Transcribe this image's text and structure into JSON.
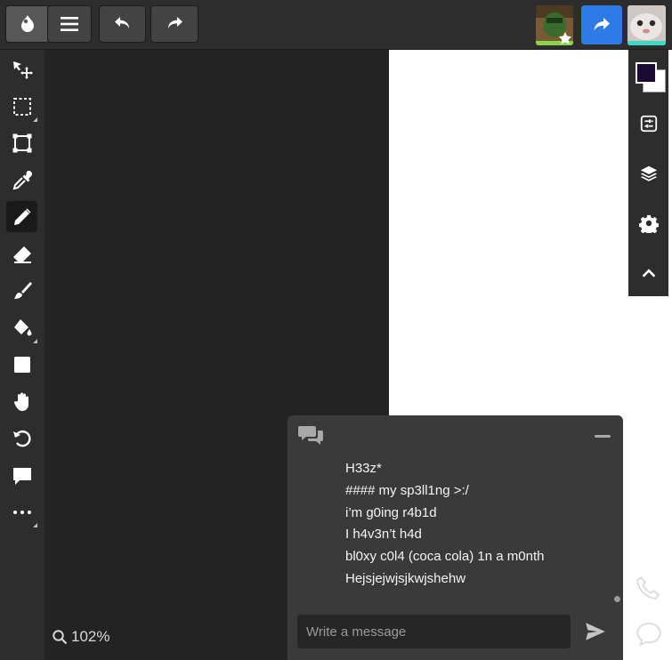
{
  "toolbar_top": {
    "logo_icon": "drawing-app-logo-icon",
    "menu_icon": "hamburger-menu-icon",
    "undo_icon": "undo-icon",
    "redo_icon": "redo-icon",
    "share_icon": "share-icon"
  },
  "tools": [
    {
      "name": "move",
      "icon": "move-icon",
      "submenu": false,
      "active": false
    },
    {
      "name": "select",
      "icon": "rect-select-icon",
      "submenu": true,
      "active": false
    },
    {
      "name": "transform",
      "icon": "transform-icon",
      "submenu": false,
      "active": false
    },
    {
      "name": "eyedropper",
      "icon": "eyedropper-icon",
      "submenu": false,
      "active": false
    },
    {
      "name": "pencil",
      "icon": "pencil-icon",
      "submenu": false,
      "active": true
    },
    {
      "name": "eraser",
      "icon": "eraser-icon",
      "submenu": false,
      "active": false
    },
    {
      "name": "brush",
      "icon": "brush-icon",
      "submenu": false,
      "active": false
    },
    {
      "name": "fill",
      "icon": "paint-bucket-icon",
      "submenu": true,
      "active": false
    },
    {
      "name": "shape",
      "icon": "square-shape-icon",
      "submenu": false,
      "active": false
    },
    {
      "name": "hand",
      "icon": "hand-icon",
      "submenu": false,
      "active": false
    },
    {
      "name": "rotate",
      "icon": "rotate-icon",
      "submenu": false,
      "active": false
    },
    {
      "name": "comment",
      "icon": "comment-icon",
      "submenu": false,
      "active": false
    },
    {
      "name": "more",
      "icon": "more-dots-icon",
      "submenu": true,
      "active": false
    }
  ],
  "zoom": {
    "label": "102%"
  },
  "right_panel": {
    "foreground_color": "#1b0a33",
    "background_color": "#ffffff",
    "buttons": [
      "adjustments-icon",
      "layers-icon",
      "settings-gear-icon",
      "chevron-up-icon"
    ]
  },
  "chat": {
    "messages": [
      "H33z*",
      "#### my sp3ll1ng >:/",
      "i’m g0ing r4b1d",
      "I h4v3n’t h4d",
      "bl0xy c0l4 (coca cola) 1n a m0nth",
      "Hejsjejwjsjkwjshehw"
    ],
    "input_placeholder": "Write a message"
  },
  "colors": {
    "accent": "#2e7be6",
    "toolbar_bg": "#2d2d2d",
    "workspace_bg": "#232323",
    "chat_bg": "#3a3a3a"
  }
}
